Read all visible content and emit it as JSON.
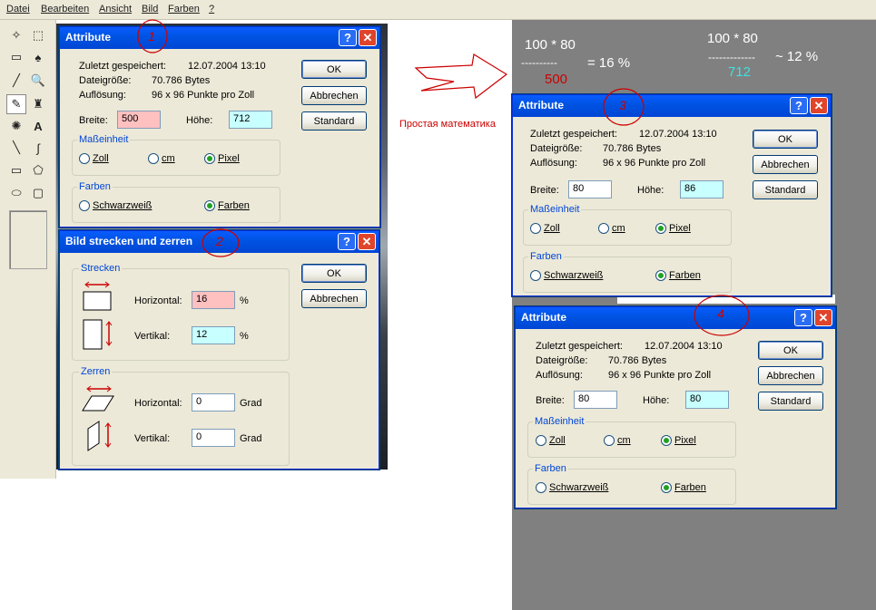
{
  "menu": [
    "Datei",
    "Bearbeiten",
    "Ansicht",
    "Bild",
    "Farben",
    "?"
  ],
  "tools": {
    "icons": [
      "free-select-icon",
      "rect-select-icon",
      "eraser-icon",
      "fill-icon",
      "color-picker-icon",
      "magnifier-icon",
      "pencil-icon",
      "brush-icon",
      "airbrush-icon",
      "text-icon",
      "line-icon",
      "curve-icon",
      "rectangle-icon",
      "polygon-icon",
      "ellipse-icon",
      "rounded-rect-icon"
    ],
    "glyphs": [
      "✧",
      "⬚",
      "▭",
      "♠",
      "╱",
      "🔍",
      "✎",
      "♜",
      "✺",
      "A",
      "╲",
      "∫",
      "▭",
      "⬠",
      "⬭",
      "▢"
    ]
  },
  "dialog1": {
    "title": "Attribute",
    "saved_label": "Zuletzt gespeichert:",
    "saved_value": "12.07.2004 13:10",
    "size_label": "Dateigröße:",
    "size_value": "70.786 Bytes",
    "res_label": "Auflösung:",
    "res_value": "96 x 96 Punkte pro Zoll",
    "width_label": "Breite:",
    "width_value": "500",
    "height_label": "Höhe:",
    "height_value": "712",
    "ok": "OK",
    "cancel": "Abbrechen",
    "standard": "Standard",
    "unit_group": "Maßeinheit",
    "unit_zoll": "Zoll",
    "unit_cm": "cm",
    "unit_pixel": "Pixel",
    "colors_group": "Farben",
    "bw": "Schwarzweiß",
    "colors": "Farben"
  },
  "dialog2": {
    "title": "Bild strecken und zerren",
    "stretch_group": "Strecken",
    "h_label": "Horizontal:",
    "h_value": "16",
    "v_label": "Vertikal:",
    "v_value": "12",
    "pct": "%",
    "skew_group": "Zerren",
    "skew_h_label": "Horizontal:",
    "skew_h_value": "0",
    "skew_v_label": "Vertikal:",
    "skew_v_value": "0",
    "grad": "Grad",
    "ok": "OK",
    "cancel": "Abbrechen"
  },
  "dialog3": {
    "title": "Attribute",
    "saved_label": "Zuletzt gespeichert:",
    "saved_value": "12.07.2004 13:10",
    "size_label": "Dateigröße:",
    "size_value": "70.786 Bytes",
    "res_label": "Auflösung:",
    "res_value": "96 x 96 Punkte pro Zoll",
    "width_label": "Breite:",
    "width_value": "80",
    "height_label": "Höhe:",
    "height_value": "86",
    "ok": "OK",
    "cancel": "Abbrechen",
    "standard": "Standard",
    "unit_group": "Maßeinheit",
    "unit_zoll": "Zoll",
    "unit_cm": "cm",
    "unit_pixel": "Pixel",
    "colors_group": "Farben",
    "bw": "Schwarzweiß",
    "colors": "Farben"
  },
  "dialog4": {
    "title": "Attribute",
    "saved_label": "Zuletzt gespeichert:",
    "saved_value": "12.07.2004 13:10",
    "size_label": "Dateigröße:",
    "size_value": "70.786 Bytes",
    "res_label": "Auflösung:",
    "res_value": "96 x 96 Punkte pro Zoll",
    "width_label": "Breite:",
    "width_value": "80",
    "height_label": "Höhe:",
    "height_value": "80",
    "ok": "OK",
    "cancel": "Abbrechen",
    "standard": "Standard",
    "unit_group": "Maßeinheit",
    "unit_zoll": "Zoll",
    "unit_cm": "cm",
    "unit_pixel": "Pixel",
    "colors_group": "Farben",
    "bw": "Schwarzweiß",
    "colors": "Farben"
  },
  "annotations": {
    "math_note": "Простая математика",
    "f1_num": "100 * 80",
    "f1_dash": "----------",
    "f1_den": "500",
    "f1_res": "= 16 %",
    "f2_num": "100 * 80",
    "f2_dash": "-------------",
    "f2_den": "712",
    "f2_res": "~ 12 %",
    "step1": "1",
    "step2": "2",
    "step3": "3",
    "step4": "4"
  },
  "colors": {
    "annot_red": "#cc0000",
    "annot_cyan": "#40e0e0",
    "xp_blue": "#0054e3"
  }
}
